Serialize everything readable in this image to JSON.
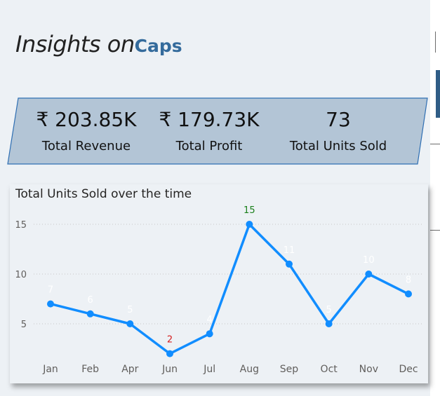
{
  "report": {
    "title": "Insights on",
    "subject": "Caps"
  },
  "kpis": [
    {
      "value": "₹ 203.85K",
      "label": "Total Revenue"
    },
    {
      "value": "₹ 179.73K",
      "label": "Total Profit"
    },
    {
      "value": "73",
      "label": "Total Units Sold"
    }
  ],
  "colors": {
    "line": "#118dff",
    "banner_fill": "#b3c5d6",
    "banner_border": "#2f6fb3",
    "max_label": "#1a7f1a",
    "min_label": "#d62020",
    "data_label": "#ffffff"
  },
  "chart_data": {
    "type": "line",
    "title": "Total Units Sold over the time",
    "categories": [
      "Jan",
      "Feb",
      "Apr",
      "Jun",
      "Jul",
      "Aug",
      "Sep",
      "Oct",
      "Nov",
      "Dec"
    ],
    "values": [
      7,
      6,
      5,
      2,
      4,
      15,
      11,
      5,
      10,
      8
    ],
    "yticks": [
      5,
      10,
      15
    ],
    "ylim": [
      0,
      17
    ],
    "grid": "horizontal-dotted",
    "max_point": {
      "category": "Aug",
      "value": 15
    },
    "min_point": {
      "category": "Jun",
      "value": 2
    }
  }
}
